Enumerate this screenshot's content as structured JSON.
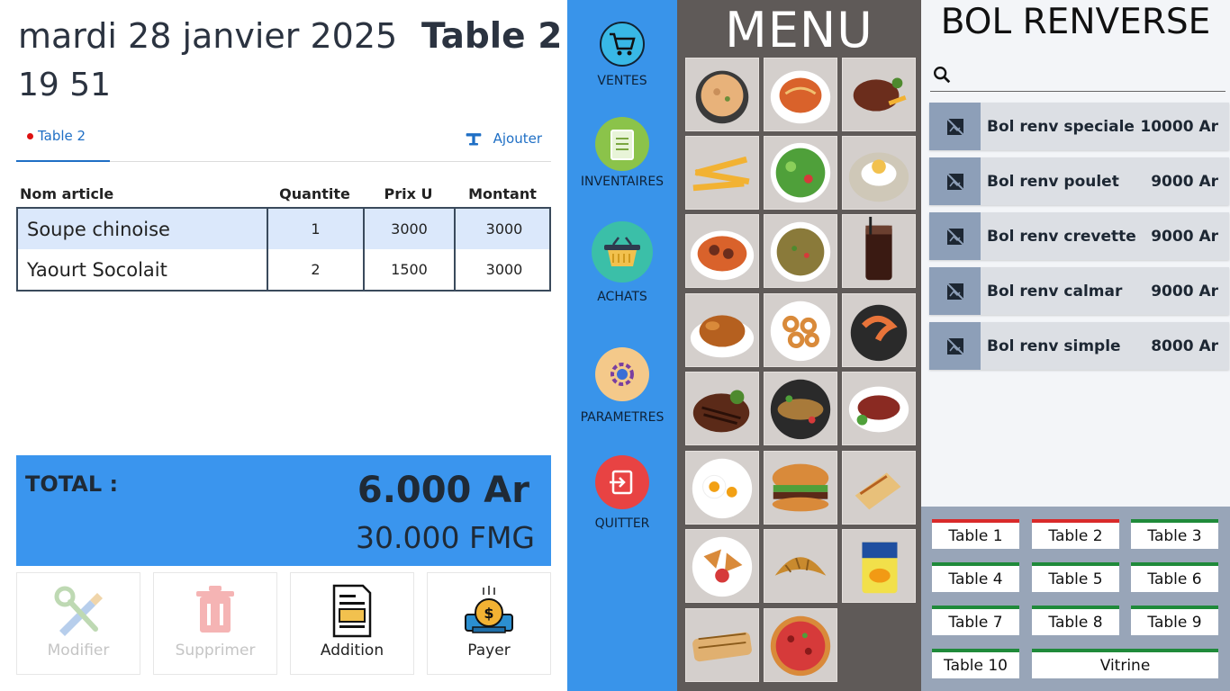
{
  "header": {
    "date": "mardi 28 janvier 2025",
    "time": "19 51",
    "table_title": "Table 2"
  },
  "tabs": {
    "active_tab": "Table 2",
    "add_label": "Ajouter"
  },
  "orders": {
    "columns": [
      "Nom article",
      "Quantite",
      "Prix U",
      "Montant"
    ],
    "rows": [
      {
        "name": "Soupe chinoise",
        "qty": "1",
        "price": "3000",
        "amount": "3000"
      },
      {
        "name": "Yaourt Socolait",
        "qty": "2",
        "price": "1500",
        "amount": "3000"
      }
    ]
  },
  "total": {
    "label": "TOTAL :",
    "ariary": "6.000 Ar",
    "fmg": "30.000 FMG"
  },
  "actions": {
    "modifier": "Modifier",
    "supprimer": "Supprimer",
    "addition": "Addition",
    "payer": "Payer"
  },
  "nav": {
    "ventes": "VENTES",
    "inventaires": "INVENTAIRES",
    "achats": "ACHATS",
    "parametres": "PARAMETRES",
    "quitter": "QUITTER"
  },
  "menu": {
    "title": "MENU",
    "tiles": [
      "soup-bowl",
      "spaghetti",
      "steak-fries",
      "french-fries",
      "salad",
      "rice-egg",
      "spaghetti-meatballs",
      "fried-rice",
      "cola-glass",
      "roast-chicken",
      "calamari-rings",
      "shrimp",
      "grilled-steak",
      "grilled-fish",
      "sliced-beef",
      "fried-eggs",
      "burger",
      "wrap",
      "samosa",
      "croissant",
      "yogurt",
      "panini",
      "pizza"
    ]
  },
  "category": {
    "title": "BOL RENVERSE",
    "search_placeholder": "",
    "products": [
      {
        "name": "Bol renv speciale",
        "price": "10000 Ar"
      },
      {
        "name": "Bol renv poulet",
        "price": "9000 Ar"
      },
      {
        "name": "Bol renv crevette",
        "price": "9000 Ar"
      },
      {
        "name": "Bol renv calmar",
        "price": "9000 Ar"
      },
      {
        "name": "Bol renv simple",
        "price": "8000 Ar"
      }
    ]
  },
  "tables": {
    "items": [
      "Table 1",
      "Table 2",
      "Table 3",
      "Table 4",
      "Table 5",
      "Table 6",
      "Table 7",
      "Table 8",
      "Table 9",
      "Table 10"
    ],
    "vitrine": "Vitrine",
    "occupied_color": "#d92a2a",
    "free_color": "#1f8a3a"
  },
  "colors": {
    "accent_blue": "#3a95ee",
    "nav_blue": "#3994ea",
    "menu_bg": "#5f5a58"
  }
}
